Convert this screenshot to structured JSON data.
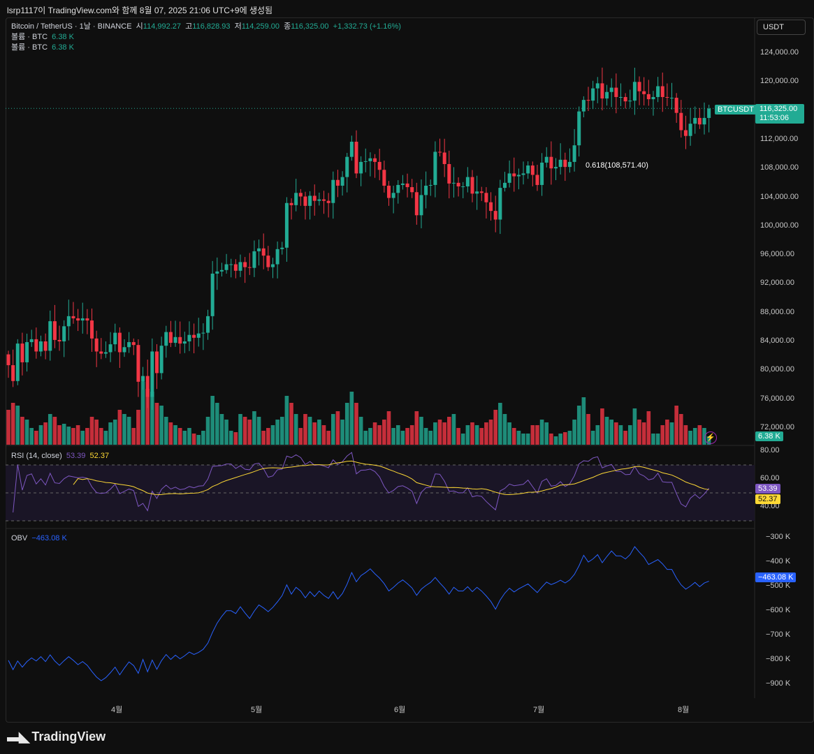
{
  "header": {
    "caption": "lsrp1117이 TradingView.com와 함께 8월 07, 2025 21:06 UTC+9에 생성됨"
  },
  "legend": {
    "symbol": "Bitcoin / TetherUS · 1날 · BINANCE",
    "o_label": "시",
    "o": "114,992.27",
    "h_label": "고",
    "h": "116,828.93",
    "l_label": "저",
    "l": "114,259.00",
    "c_label": "종",
    "c": "116,325.00",
    "change": "+1,332.73 (+1.16%)",
    "vol1_label": "볼륨 · BTC",
    "vol1": "6.38 K",
    "vol2_label": "볼륨 · BTC",
    "vol2": "6.38 K"
  },
  "currency_button": "USDT",
  "price_axis": [
    "124,000.00",
    "120,000.00",
    "116,000.00",
    "112,000.00",
    "108,000.00",
    "104,000.00",
    "100,000.00",
    "96,000.00",
    "92,000.00",
    "88,000.00",
    "84,000.00",
    "80,000.00",
    "76,000.00",
    "72,000.00"
  ],
  "last_price": {
    "symbol": "BTCUSDT",
    "price": "116,325.00",
    "countdown": "11:53:06"
  },
  "volume_tag": "6.38 K",
  "fib_label": "0.618(108,571.40)",
  "rsi": {
    "title": "RSI (14, close)",
    "value": "53.39",
    "ma": "52.37",
    "axis": [
      "80.00",
      "60.00",
      "40.00"
    ]
  },
  "obv": {
    "title": "OBV",
    "value": "−463.08 K",
    "axis": [
      "−300 K",
      "−400 K",
      "−500 K",
      "−600 K",
      "−700 K",
      "−800 K",
      "−900 K"
    ]
  },
  "x_axis": [
    "4월",
    "5월",
    "6월",
    "7월",
    "8월"
  ],
  "brand": "TradingView",
  "colors": {
    "up": "#22ab94",
    "down": "#f23645",
    "rsi": "#7e57c2",
    "rsi_ma": "#fdd835",
    "obv": "#2962ff"
  },
  "chart_data": {
    "type": "candlestick",
    "start_date": "2025-03-09",
    "closes_k": [
      80.7,
      78.5,
      83.7,
      81.1,
      83.9,
      84.3,
      82.6,
      84.0,
      82.7,
      86.8,
      84.2,
      84.0,
      86.1,
      87.5,
      87.2,
      86.9,
      87.2,
      86.9,
      84.4,
      82.6,
      82.3,
      82.5,
      83.6,
      85.2,
      82.5,
      83.2,
      83.9,
      83.5,
      78.4,
      79.2,
      76.3,
      82.6,
      79.6,
      83.4,
      85.3,
      83.8,
      84.6,
      83.7,
      84.0,
      84.9,
      84.5,
      85.1,
      85.2,
      87.5,
      93.4,
      93.7,
      93.9,
      94.7,
      94.7,
      93.8,
      95.0,
      94.3,
      94.2,
      96.5,
      96.9,
      95.9,
      94.3,
      94.7,
      96.8,
      97.0,
      103.2,
      102.9,
      104.6,
      104.1,
      102.8,
      104.2,
      103.5,
      103.7,
      103.5,
      103.2,
      106.4,
      105.6,
      106.8,
      109.6,
      111.7,
      107.3,
      108.9,
      109.0,
      109.4,
      108.9,
      107.8,
      105.6,
      103.9,
      104.6,
      105.7,
      105.9,
      105.4,
      104.7,
      101.5,
      104.3,
      105.6,
      105.7,
      110.3,
      110.2,
      108.6,
      105.9,
      106.0,
      105.5,
      105.5,
      106.8,
      104.5,
      104.8,
      104.6,
      103.3,
      102.1,
      100.9,
      105.3,
      106.0,
      107.3,
      106.9,
      107.1,
      107.3,
      108.4,
      107.1,
      105.7,
      108.8,
      109.6,
      108.0,
      108.2,
      109.2,
      108.2,
      108.9,
      111.2,
      115.9,
      117.5,
      117.4,
      119.1,
      119.8,
      117.7,
      118.6,
      119.2,
      117.9,
      117.9,
      117.3,
      117.4,
      120.0,
      118.7,
      118.3,
      117.6,
      117.9,
      119.4,
      117.9,
      117.8,
      117.8,
      115.7,
      113.3,
      112.5,
      114.2,
      115.0,
      114.1,
      115.0,
      116.3
    ],
    "volumes_k": [
      25,
      30,
      28,
      20,
      18,
      12,
      10,
      14,
      16,
      22,
      20,
      14,
      15,
      13,
      12,
      14,
      10,
      12,
      20,
      18,
      12,
      10,
      16,
      18,
      25,
      22,
      20,
      12,
      25,
      45,
      40,
      38,
      30,
      28,
      20,
      16,
      14,
      12,
      10,
      12,
      8,
      7,
      10,
      20,
      35,
      30,
      22,
      18,
      10,
      9,
      22,
      20,
      18,
      24,
      20,
      10,
      12,
      14,
      18,
      20,
      35,
      30,
      22,
      12,
      22,
      20,
      16,
      18,
      14,
      10,
      22,
      24,
      18,
      30,
      38,
      30,
      20,
      10,
      12,
      16,
      14,
      18,
      24,
      12,
      14,
      10,
      12,
      14,
      24,
      20,
      12,
      10,
      16,
      18,
      16,
      20,
      22,
      12,
      8,
      14,
      16,
      14,
      12,
      16,
      18,
      25,
      30,
      22,
      16,
      12,
      10,
      8,
      8,
      14,
      14,
      18,
      16,
      8,
      6,
      8,
      9,
      10,
      18,
      28,
      34,
      22,
      10,
      14,
      26,
      20,
      18,
      16,
      14,
      10,
      14,
      26,
      18,
      16,
      24,
      8,
      8,
      14,
      18,
      16,
      28,
      22,
      14,
      10,
      12,
      14,
      12,
      6
    ],
    "price_range": [
      70000,
      126000
    ],
    "rsi_range": [
      30,
      85
    ],
    "obv_last_k": -463.08
  }
}
